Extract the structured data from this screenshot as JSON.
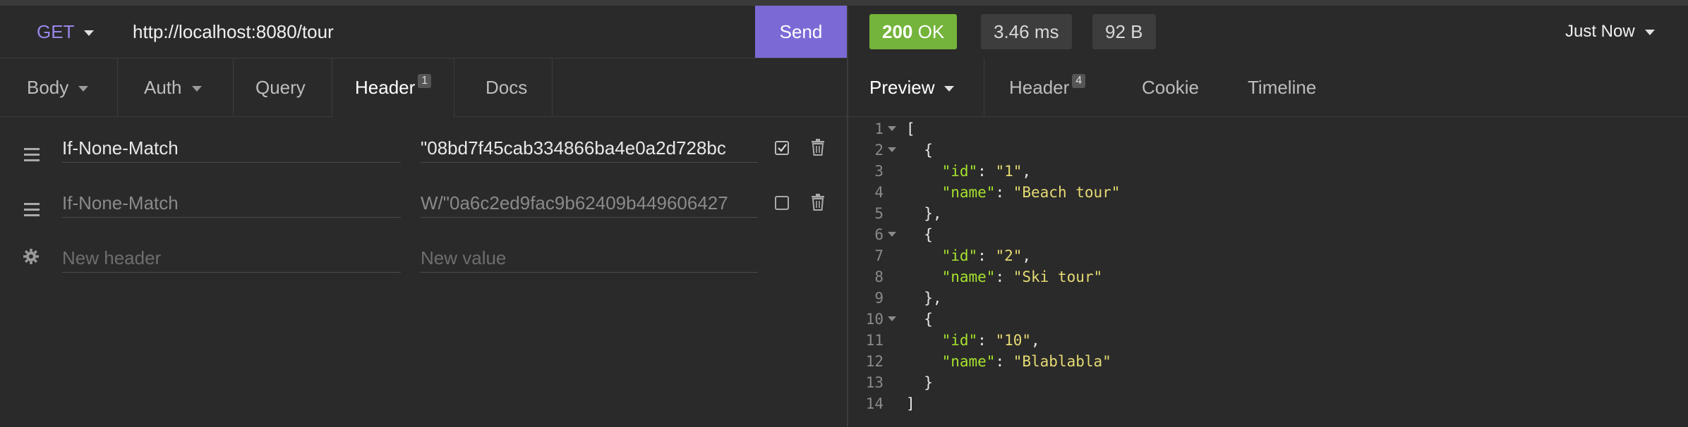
{
  "request": {
    "method": "GET",
    "url": "http://localhost:8080/tour",
    "send_label": "Send"
  },
  "request_tabs": [
    {
      "label": "Body"
    },
    {
      "label": "Auth"
    },
    {
      "label": "Query"
    },
    {
      "label": "Header",
      "badge": "1"
    },
    {
      "label": "Docs"
    }
  ],
  "headers": [
    {
      "name": "If-None-Match",
      "value": "\"08bd7f45cab334866ba4e0a2d728bc",
      "enabled": true
    },
    {
      "name": "If-None-Match",
      "value": "W/\"0a6c2ed9fac9b62409b449606427",
      "enabled": false
    }
  ],
  "new_header": {
    "name_placeholder": "New header",
    "value_placeholder": "New value"
  },
  "response": {
    "status_code": "200",
    "status_text": "OK",
    "time": "3.46 ms",
    "size": "92 B",
    "history_label": "Just Now"
  },
  "response_tabs": [
    {
      "label": "Preview"
    },
    {
      "label": "Header",
      "badge": "4"
    },
    {
      "label": "Cookie"
    },
    {
      "label": "Timeline"
    }
  ],
  "response_body": [
    {
      "num": "1",
      "text": "[",
      "fold": true
    },
    {
      "num": "2",
      "text": "  {",
      "fold": true
    },
    {
      "num": "3",
      "key": "id",
      "val": "1",
      "comma": true
    },
    {
      "num": "4",
      "key": "name",
      "val": "Beach tour"
    },
    {
      "num": "5",
      "text": "  },"
    },
    {
      "num": "6",
      "text": "  {",
      "fold": true
    },
    {
      "num": "7",
      "key": "id",
      "val": "2",
      "comma": true
    },
    {
      "num": "8",
      "key": "name",
      "val": "Ski tour"
    },
    {
      "num": "9",
      "text": "  },"
    },
    {
      "num": "10",
      "text": "  {",
      "fold": true
    },
    {
      "num": "11",
      "key": "id",
      "val": "10",
      "comma": true
    },
    {
      "num": "12",
      "key": "name",
      "val": "Blablabla"
    },
    {
      "num": "13",
      "text": "  }"
    },
    {
      "num": "14",
      "text": "]"
    }
  ],
  "colors": {
    "accent": "#7b6ad6",
    "method": "#9a86e8",
    "status_ok": "#74b43b",
    "json_key": "#a6e22e",
    "json_string": "#e6db74"
  }
}
